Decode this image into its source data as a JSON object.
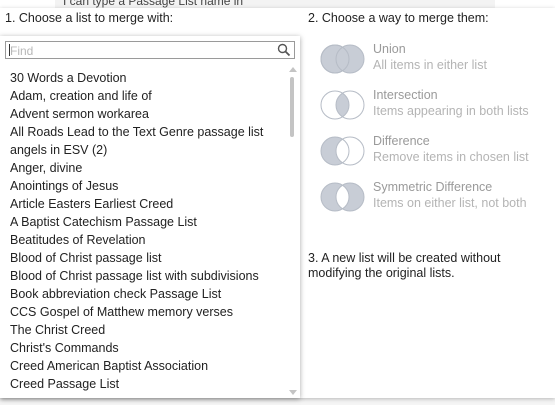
{
  "background": {
    "field_text": "I can type a Passage List name in"
  },
  "step1": {
    "heading": "1. Choose a list to merge with:"
  },
  "search": {
    "placeholder": "Find",
    "icon": "search-icon"
  },
  "lists": [
    "30 Words a Devotion",
    "Adam, creation and life of",
    "Advent sermon workarea",
    "All Roads Lead to the Text Genre passage list",
    "angels in ESV (2)",
    "Anger, divine",
    "Anointings of Jesus",
    "Article Easters Earliest Creed",
    "A Baptist Catechism Passage List",
    "Beatitudes of Revelation",
    "Blood of Christ passage list",
    "Blood of Christ passage list with subdivisions",
    "Book abbreviation check Passage List",
    "CCS Gospel of Matthew memory verses",
    "The Christ Creed",
    "Christ's Commands",
    "Creed American Baptist Association",
    "Creed Passage List"
  ],
  "step2": {
    "heading": "2. Choose a way to merge them:",
    "options": [
      {
        "title": "Union",
        "description": "All items in either list",
        "icon": "union-venn-icon"
      },
      {
        "title": "Intersection",
        "description": "Items appearing in both lists",
        "icon": "intersection-venn-icon"
      },
      {
        "title": "Difference",
        "description": "Remove items in chosen list",
        "icon": "difference-venn-icon"
      },
      {
        "title": "Symmetric Difference",
        "description": "Items on either list, not both",
        "icon": "symmetric-difference-venn-icon"
      }
    ]
  },
  "step3": {
    "note": "3. A new list will be created without modifying the original lists."
  },
  "colors": {
    "venn_fill": "#c8cdd6",
    "venn_stroke": "#b6bcc6",
    "option_text": "#9a9a9a",
    "option_desc": "#b4b4b4"
  }
}
